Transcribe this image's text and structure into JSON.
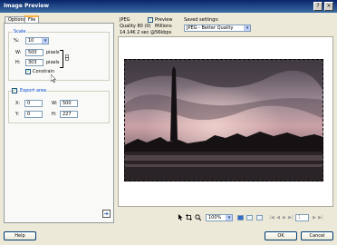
{
  "window": {
    "title": "Image Preview"
  },
  "tabs": [
    {
      "label": "Options"
    },
    {
      "label": "File"
    }
  ],
  "scale": {
    "group_label": "Scale",
    "percent_label": "%:",
    "percent_value": "10",
    "width_label": "W:",
    "width_value": "500",
    "width_unit": "pixels",
    "height_label": "H:",
    "height_value": "303",
    "height_unit": "pixels",
    "constrain_label": "Constrain",
    "constrain_checked": true
  },
  "export_area": {
    "label": "Export area",
    "checked": true,
    "x_label": "X:",
    "x_value": "0",
    "w_label": "W:",
    "w_value": "500",
    "y_label": "Y:",
    "y_value": "0",
    "h_label": "H:",
    "h_value": "227"
  },
  "info": {
    "format": "JPEG",
    "quality": "Quality 80 (0)",
    "size_time": "14.14K  2 sec @56kbps",
    "preview_label": "Preview",
    "preview_checked": true,
    "colors": "Millions"
  },
  "saved_settings": {
    "label": "Saved settings:",
    "value": "JPEG - Better Quality"
  },
  "zoom": {
    "value": "100%"
  },
  "page_field": "1",
  "buttons": {
    "help": "Help",
    "ok": "OK",
    "cancel": "Cancel"
  },
  "icons": {
    "pointer": "pointer-icon",
    "crop": "crop-icon",
    "zoom": "zoom-icon",
    "export_wizard": "export-wizard-icon"
  }
}
